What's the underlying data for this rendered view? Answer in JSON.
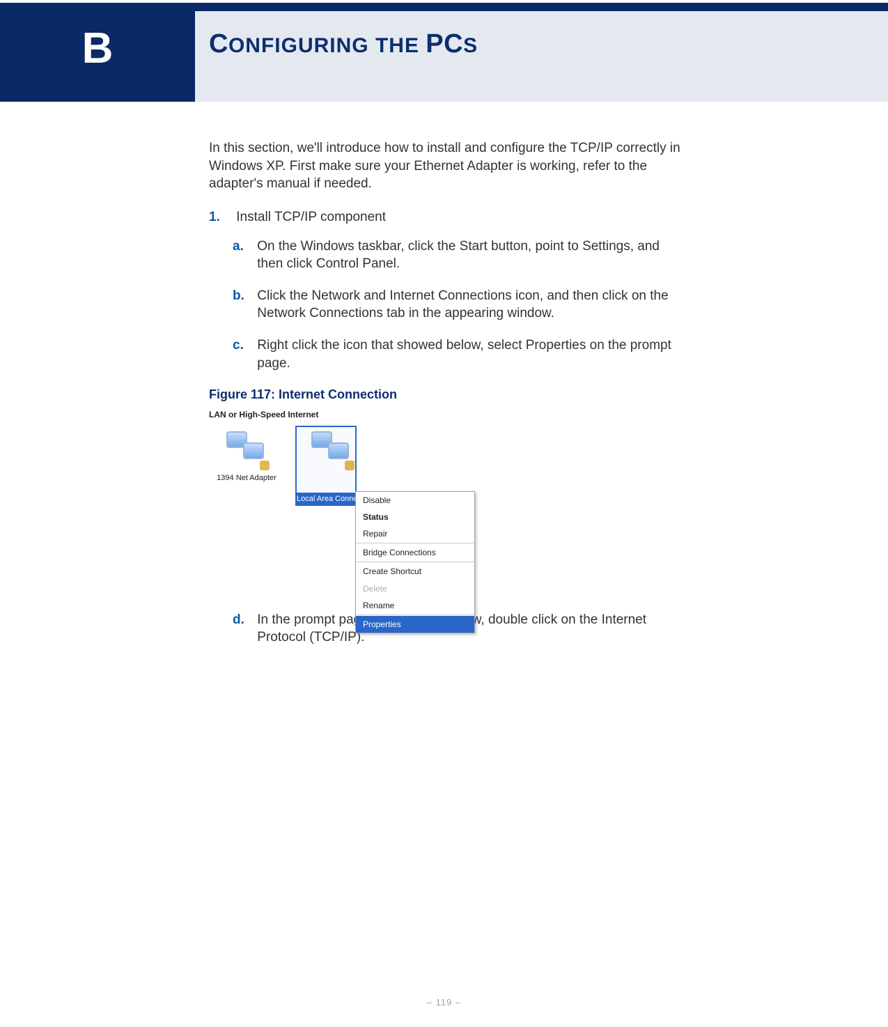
{
  "appendix_letter": "B",
  "page_title_prefix": "C",
  "page_title_small1": "ONFIGURING THE ",
  "page_title_word2": "PC",
  "page_title_small2": "S",
  "content": {
    "intro": "In this section, we'll introduce how to install and configure the TCP/IP correctly in Windows XP. First make sure your Ethernet Adapter is working, refer to the adapter's manual if needed.",
    "step1_num": "1.",
    "step1_text": "Install TCP/IP component",
    "a_label": "a.",
    "a_text": "On the Windows taskbar, click the Start button, point to Settings, and then click Control Panel.",
    "b_label": "b.",
    "b_text": "Click the Network and Internet Connections icon, and then click on the Network Connections tab in the appearing window.",
    "c_label": "c.",
    "c_text": "Right click the icon that showed below, select Properties on the prompt page.",
    "fig_caption": "Figure 117:  Internet Connection",
    "d_label": "d.",
    "d_text": "In the prompt page that showed below, double click on the Internet Protocol (TCP/IP)."
  },
  "screenshot": {
    "section_header": "LAN or High-Speed Internet",
    "item1_label": "1394 Net Adapter",
    "item2_label": "Local Area Conne",
    "menu": {
      "disable": "Disable",
      "status": "Status",
      "repair": "Repair",
      "bridge": "Bridge Connections",
      "shortcut": "Create Shortcut",
      "delete": "Delete",
      "rename": "Rename",
      "properties": "Properties"
    }
  },
  "page_number": "–  119  –"
}
